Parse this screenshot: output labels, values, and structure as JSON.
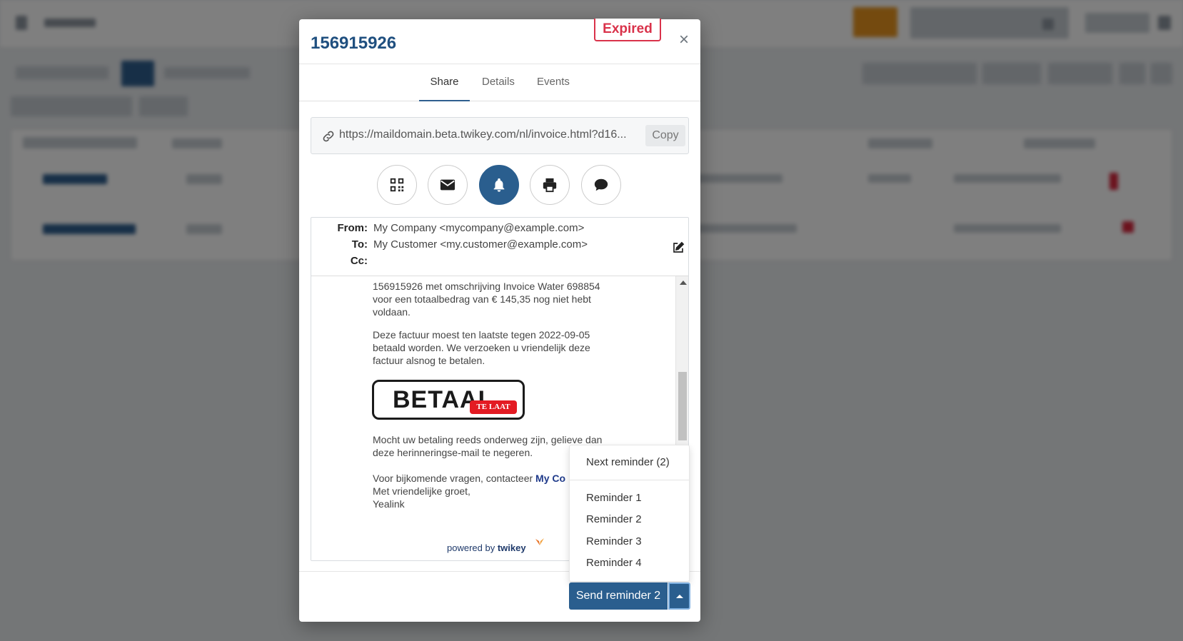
{
  "modal": {
    "title": "156915926",
    "status_badge": "Expired",
    "close_glyph": "×",
    "tabs": [
      {
        "label": "Share",
        "active": true
      },
      {
        "label": "Details",
        "active": false
      },
      {
        "label": "Events",
        "active": false
      }
    ],
    "share_url": "https://maildomain.beta.twikey.com/nl/invoice.html?d16...",
    "copy_label": "Copy",
    "share_actions": [
      {
        "icon": "qr-code-icon",
        "active": false
      },
      {
        "icon": "envelope-icon",
        "active": false
      },
      {
        "icon": "bell-icon",
        "active": true
      },
      {
        "icon": "printer-icon",
        "active": false
      },
      {
        "icon": "chat-bubble-icon",
        "active": false
      }
    ]
  },
  "email": {
    "from_label": "From:",
    "from_value": "My Company <mycompany@example.com>",
    "to_label": "To:",
    "to_value": "My Customer <my.customer@example.com>",
    "cc_label": "Cc:",
    "cc_value": "",
    "body": {
      "para1_line1": "156915926 met omschrijving Invoice Water 698854",
      "para1_line2": "voor een totaalbedrag van € 145,35 nog niet hebt",
      "para1_line3": "voldaan.",
      "para2_line1": "Deze factuur moest ten laatste tegen 2022-09-05",
      "para2_line2": "betaald worden. We verzoeken u vriendelijk deze",
      "para2_line3": "factuur alsnog te betalen.",
      "logo_word": "BETAAL",
      "logo_tag": "TE LAAT",
      "para3_line1": "Mocht uw betaling reeds onderweg zijn, gelieve dan",
      "para3_line2": "deze herinneringse-mail te negeren.",
      "contact_prefix": "Voor bijkomende vragen, contacteer",
      "contact_link": "My Co",
      "greeting": "Met vriendelijke groet,",
      "signature": "Yealink",
      "powered_prefix": "powered by",
      "powered_brand": "twikey"
    }
  },
  "reminder_menu": {
    "next_reminder": "Next reminder (2)",
    "items": [
      "Reminder 1",
      "Reminder 2",
      "Reminder 3",
      "Reminder 4"
    ]
  },
  "send_button": {
    "label": "Send reminder 2"
  },
  "colors": {
    "primary": "#2a5e8e",
    "title": "#1f4f7f",
    "expired": "#d9324a",
    "overlay": "rgba(0,0,0,0.5)"
  }
}
